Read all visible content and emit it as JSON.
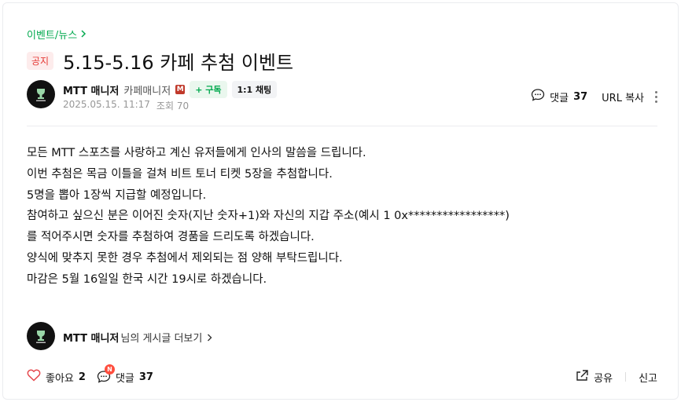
{
  "board": {
    "label": "이벤트/뉴스"
  },
  "post": {
    "badge": "공지",
    "title": "5.15-5.16 카페 추첨 이벤트"
  },
  "author": {
    "name": "MTT 매니저",
    "grade": "카페매니저",
    "manager_mark": "M",
    "subscribe_label": "+ 구독",
    "chat_label": "1:1 채팅"
  },
  "meta": {
    "date": "2025.05.15. 11:17",
    "views": "조회 70"
  },
  "actions": {
    "comment_label": "댓글",
    "comment_count": "37",
    "url_copy": "URL 복사"
  },
  "content": {
    "lines": [
      "모든 MTT 스포츠를 사랑하고 계신 유저들에게 인사의 말씀을 드립니다.",
      "이번 추첨은 목금 이틀을 걸쳐 비트 토너 티켓 5장을 추첨합니다.",
      "5명을 뽑아 1장씩 지급할 예정입니다.",
      "참여하고 싶으신 분은 이어진 숫자(지난 숫자+1)와 자신의 지갑 주소(예시 1 0x*****************)",
      "를 적어주시면 숫자를 추첨하여 경품을 드리도록 하겠습니다.",
      "양식에 맞추지 못한 경우 추첨에서 제외되는 점 양해 부탁드립니다.",
      "마감은 5월 16일일 한국 시간 19시로 하겠습니다."
    ]
  },
  "author_posts": {
    "name": "MTT 매니저",
    "suffix": "님의 게시글 더보기"
  },
  "bottom": {
    "like_label": "좋아요",
    "like_count": "2",
    "comment_label": "댓글",
    "comment_count": "37",
    "new_badge": "N",
    "share_label": "공유",
    "report_label": "신고"
  },
  "colors": {
    "accent_green": "#03a94f",
    "notice_red": "#e53935",
    "like_red": "#e5484d"
  },
  "icons": [
    "chevron-right-icon",
    "avatar-logo",
    "comment-icon",
    "kebab-icon",
    "heart-icon",
    "share-icon"
  ]
}
